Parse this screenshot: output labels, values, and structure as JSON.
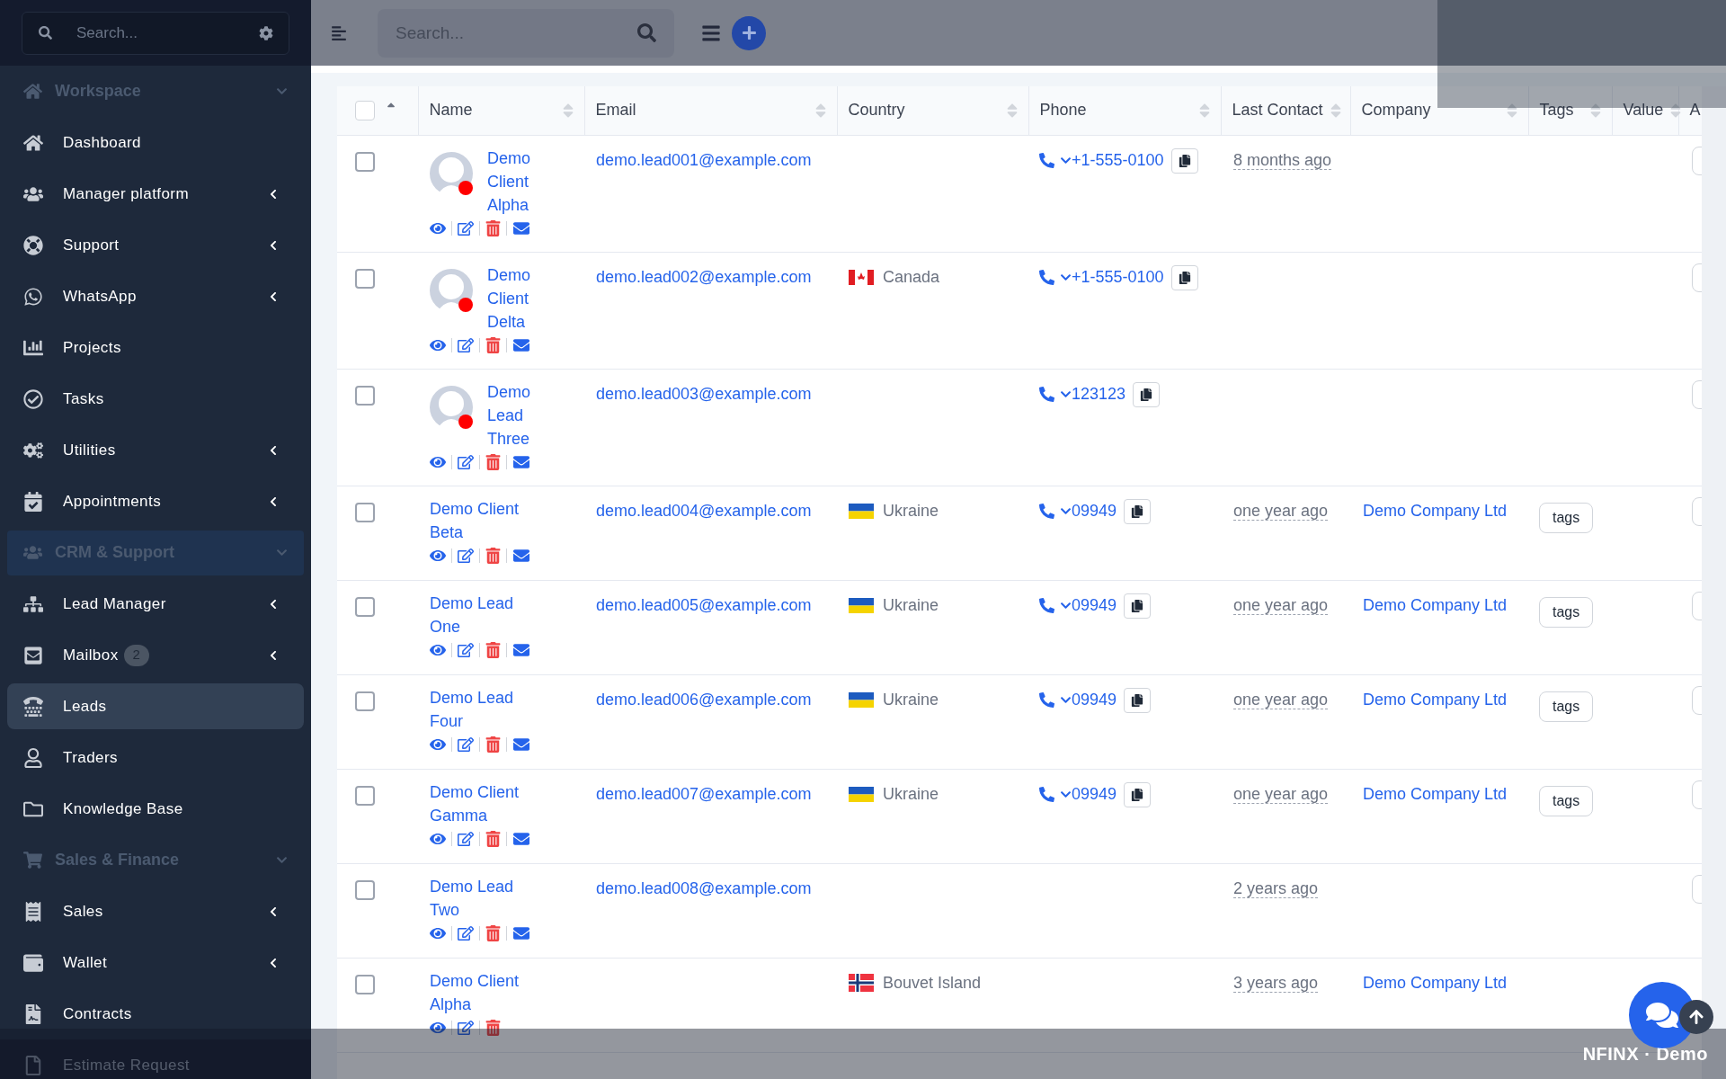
{
  "sidebar": {
    "search": {
      "placeholder": "Search..."
    },
    "items": [
      {
        "kind": "section",
        "label": "Workspace",
        "highlighted": false
      },
      {
        "kind": "item",
        "label": "Dashboard",
        "expandable": false,
        "selected": false
      },
      {
        "kind": "item",
        "label": "Manager platform",
        "expandable": true,
        "selected": false
      },
      {
        "kind": "item",
        "label": "Support",
        "expandable": true,
        "selected": false
      },
      {
        "kind": "item",
        "label": "WhatsApp",
        "expandable": true,
        "selected": false
      },
      {
        "kind": "item",
        "label": "Projects",
        "expandable": false,
        "selected": false
      },
      {
        "kind": "item",
        "label": "Tasks",
        "expandable": false,
        "selected": false
      },
      {
        "kind": "item",
        "label": "Utilities",
        "expandable": true,
        "selected": false
      },
      {
        "kind": "item",
        "label": "Appointments",
        "expandable": true,
        "selected": false
      },
      {
        "kind": "section",
        "label": "CRM & Support",
        "highlighted": true
      },
      {
        "kind": "item",
        "label": "Lead Manager",
        "expandable": true,
        "selected": false
      },
      {
        "kind": "item",
        "label": "Mailbox",
        "badge": "2",
        "expandable": true,
        "selected": false
      },
      {
        "kind": "item",
        "label": "Leads",
        "expandable": false,
        "selected": true
      },
      {
        "kind": "item",
        "label": "Traders",
        "expandable": false,
        "selected": false
      },
      {
        "kind": "item",
        "label": "Knowledge Base",
        "expandable": false,
        "selected": false
      },
      {
        "kind": "section",
        "label": "Sales & Finance",
        "highlighted": false
      },
      {
        "kind": "item",
        "label": "Sales",
        "expandable": true,
        "selected": false
      },
      {
        "kind": "item",
        "label": "Wallet",
        "expandable": true,
        "selected": false
      },
      {
        "kind": "item",
        "label": "Contracts",
        "expandable": false,
        "selected": false
      },
      {
        "kind": "item",
        "label": "Estimate Request",
        "expandable": false,
        "selected": false
      }
    ]
  },
  "header": {
    "search": {
      "placeholder": "Search..."
    }
  },
  "table": {
    "select_all_checked": false,
    "columns": [
      "Name",
      "Email",
      "Country",
      "Phone",
      "Last Contact",
      "Company",
      "Tags",
      "Value",
      "A"
    ],
    "rows": [
      {
        "checked": false,
        "avatar": true,
        "name": "Demo Client Alpha",
        "email": "demo.lead001@example.com",
        "phone": "+1-555-0100",
        "last_contact": "8 months ago"
      },
      {
        "checked": false,
        "avatar": true,
        "name": "Demo Client Delta",
        "email": "demo.lead002@example.com",
        "country": {
          "kind": "canada",
          "name": "Canada"
        },
        "phone": "+1-555-0100"
      },
      {
        "checked": false,
        "avatar": true,
        "name": "Demo Lead Three",
        "email": "demo.lead003@example.com",
        "phone": "123123"
      },
      {
        "checked": false,
        "avatar": false,
        "name": "Demo Client Beta",
        "email": "demo.lead004@example.com",
        "country": {
          "kind": "ukraine",
          "name": "Ukraine"
        },
        "phone": "09949",
        "last_contact": "one year ago",
        "company": "Demo Company Ltd",
        "tags": "tags"
      },
      {
        "checked": false,
        "avatar": false,
        "name": "Demo Lead One",
        "email": "demo.lead005@example.com",
        "country": {
          "kind": "ukraine",
          "name": "Ukraine"
        },
        "phone": "09949",
        "last_contact": "one year ago",
        "company": "Demo Company Ltd",
        "tags": "tags"
      },
      {
        "checked": false,
        "avatar": false,
        "name": "Demo Lead Four",
        "email": "demo.lead006@example.com",
        "country": {
          "kind": "ukraine",
          "name": "Ukraine"
        },
        "phone": "09949",
        "last_contact": "one year ago",
        "company": "Demo Company Ltd",
        "tags": "tags"
      },
      {
        "checked": false,
        "avatar": false,
        "name": "Demo Client Gamma",
        "email": "demo.lead007@example.com",
        "country": {
          "kind": "ukraine",
          "name": "Ukraine"
        },
        "phone": "09949",
        "last_contact": "one year ago",
        "company": "Demo Company Ltd",
        "tags": "tags"
      },
      {
        "checked": false,
        "avatar": false,
        "name": "Demo Lead Two",
        "email": "demo.lead008@example.com",
        "last_contact": "2 years ago"
      },
      {
        "checked": false,
        "avatar": false,
        "name": "Demo Client Alpha",
        "country": {
          "kind": "norway",
          "name": "Bouvet Island"
        },
        "last_contact": "3 years ago",
        "company": "Demo Company Ltd"
      }
    ]
  },
  "footer_label": "NFINX · Demo"
}
